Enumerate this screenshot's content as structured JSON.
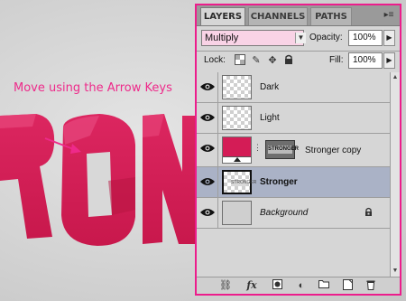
{
  "canvas": {
    "hint_text": "Move using the Arrow Keys",
    "text_color": "#d41c56",
    "hint_color": "#ee2a8a"
  },
  "panel": {
    "border_color": "#ec1d8c",
    "tabs": [
      {
        "label": "LAYERS",
        "active": true
      },
      {
        "label": "CHANNELS",
        "active": false
      },
      {
        "label": "PATHS",
        "active": false
      }
    ],
    "menu_icon": "panel-menu-icon",
    "blend_mode": "Multiply",
    "opacity_label": "Opacity:",
    "opacity_value": "100%",
    "lock_label": "Lock:",
    "lock_icons": [
      "lock-transparent-icon",
      "lock-image-icon",
      "lock-position-icon",
      "lock-all-icon"
    ],
    "fill_label": "Fill:",
    "fill_value": "100%",
    "layers": [
      {
        "name": "Dark",
        "visible": true,
        "selected": false
      },
      {
        "name": "Light",
        "visible": true,
        "selected": false
      },
      {
        "name": "Stronger copy",
        "visible": true,
        "selected": false,
        "mask_text": "STRONGER"
      },
      {
        "name": "Stronger",
        "visible": true,
        "selected": true,
        "thumb_text": "STRONGER"
      },
      {
        "name": "Background",
        "visible": true,
        "selected": false,
        "locked": true
      }
    ],
    "bottom_icons": [
      "link-layers-icon",
      "fx",
      "add-mask-icon",
      "adjustment-layer-icon",
      "new-group-icon",
      "new-layer-icon",
      "delete-layer-icon"
    ]
  }
}
